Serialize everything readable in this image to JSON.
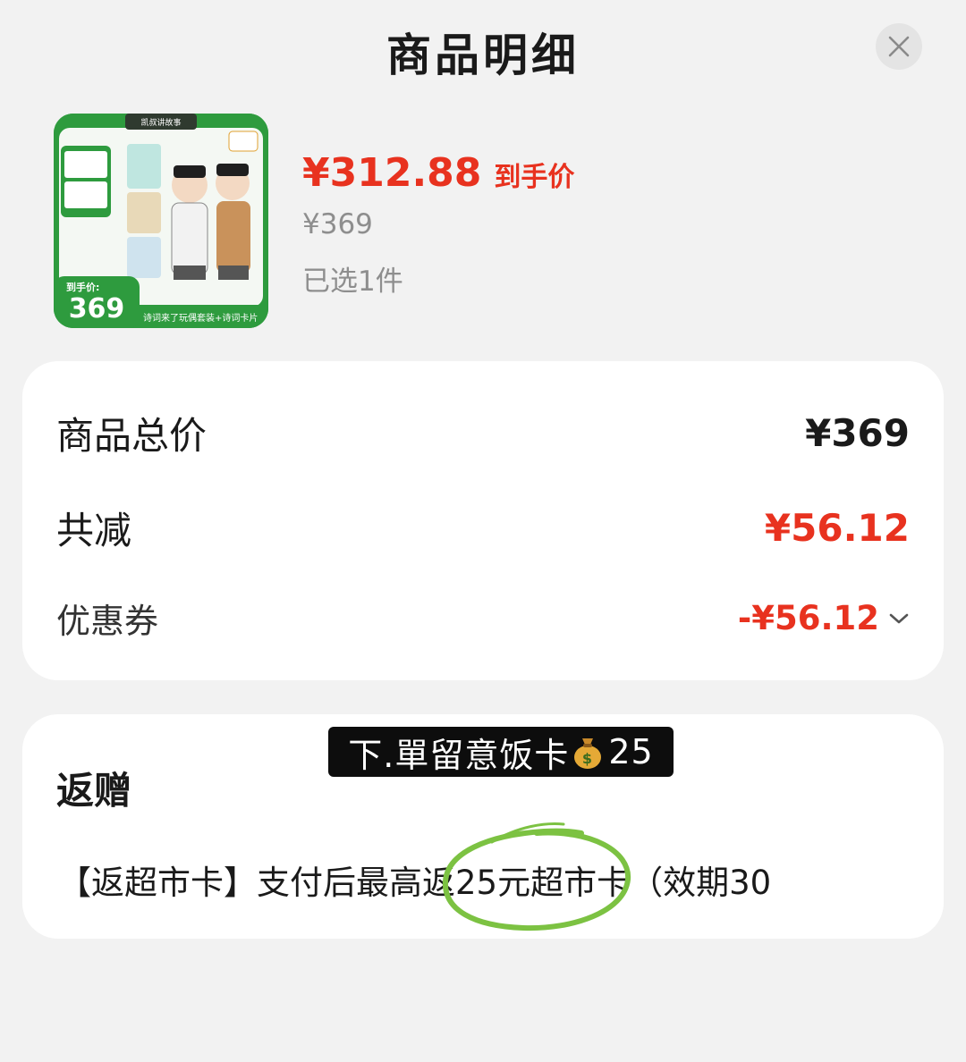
{
  "header": {
    "title": "商品明细",
    "close_icon": "close-icon"
  },
  "product": {
    "image_top_text": "凯叔讲故事",
    "image_badge_label": "到手价:",
    "image_badge_price": "369",
    "image_bottom_text": "诗词来了玩偶套装+诗词卡片",
    "deal_price": "¥312.88",
    "deal_label": "到手价",
    "original_price": "¥369",
    "selected_count": "已选1件"
  },
  "summary": {
    "total_label": "商品总价",
    "total_value": "¥369",
    "discount_label": "共减",
    "discount_value": "¥56.12",
    "coupon_label": "优惠券",
    "coupon_value": "-¥56.12",
    "coupon_icon": "chevron-down-icon"
  },
  "gift": {
    "title": "返赠",
    "description": "【返超市卡】支付后最高返25元超市卡（效期30"
  },
  "overlay": {
    "text_before": "下.單留意饭卡",
    "icon": "money-bag-icon",
    "amount": "25"
  },
  "colors": {
    "accent_red": "#e8321f",
    "muted_gray": "#8e8e8e",
    "highlight_green": "#7cc242"
  }
}
